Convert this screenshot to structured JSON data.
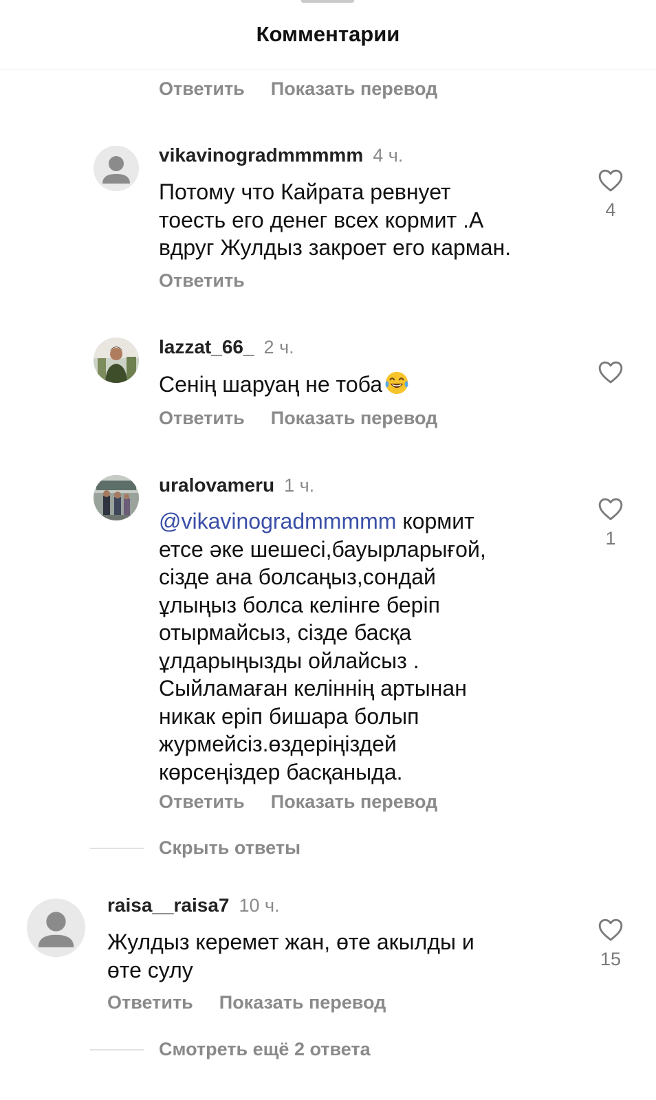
{
  "header": {
    "title": "Комментарии"
  },
  "actions": {
    "reply": "Ответить",
    "translate": "Показать перевод"
  },
  "comments": [
    {
      "username": "vikavinogradmmmmm",
      "time": "4 ч.",
      "lines": [
        "Потому что Кайрата ревнует",
        "тоесть его денег всех кормит .А",
        "вдруг Жулдыз закроет его карман."
      ],
      "likes": "4"
    },
    {
      "username": "lazzat_66_",
      "time": "2 ч.",
      "text": "Сенің шаруаң не тоба"
    },
    {
      "username": "uralovameru",
      "time": "1 ч.",
      "mention": "@vikavinogradmmmmm",
      "first_line_rest": " кормит",
      "lines": [
        "етсе әке шешесі,бауырларығой,",
        "сізде ана болсаңыз,сондай",
        "ұлыңыз болса келінге беріп",
        "отырмайсыз, сізде басқа",
        "ұлдарыңызды ойлайсыз .",
        "Сыйламаған келіннің артынан",
        "никак еріп бишара болып",
        "журмейсіз.өздеріңіздей",
        "көрсеңіздер басқаныда."
      ],
      "likes": "1"
    },
    {
      "username": "raisa__raisa7",
      "time": "10 ч.",
      "lines": [
        "Жулдыз керемет жан, өте акылды и",
        "өте сулу"
      ],
      "likes": "15"
    }
  ],
  "threads": {
    "hide_replies": "Скрыть ответы",
    "view_more": "Смотреть ещё 2 ответа"
  },
  "colors": {
    "mention": "#3a4fa8",
    "muted": "#8a8a8a"
  }
}
